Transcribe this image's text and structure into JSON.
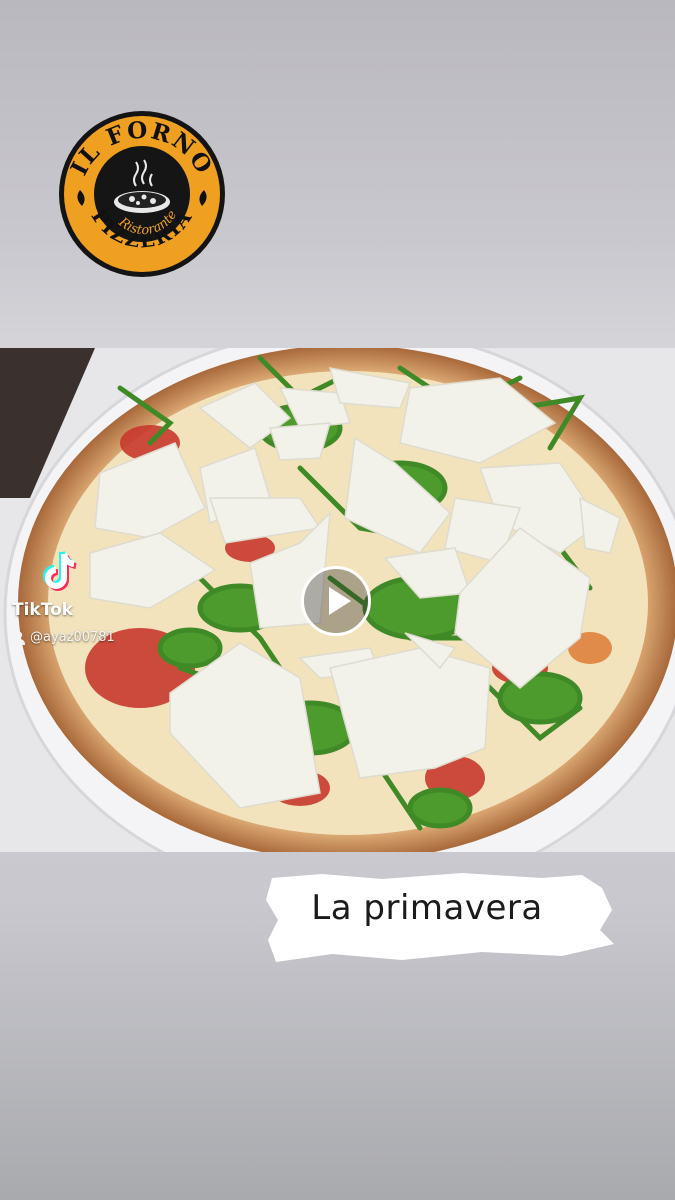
{
  "logo": {
    "arc_top": "IL FORNO",
    "script_text": "Ristorante",
    "arc_bottom": "PIZZERIA"
  },
  "tiktok": {
    "brand": "TikTok",
    "username": "@ayaz00781",
    "icon": "tiktok-logo-icon",
    "user_icon": "person-icon"
  },
  "player": {
    "play_icon": "play-icon"
  },
  "caption": {
    "text": "La primavera"
  },
  "colors": {
    "logo_orange": "#f0a020",
    "logo_black": "#171717",
    "arugula": "#3f8a27",
    "crust": "#d39b62",
    "tomato": "#c8392d"
  }
}
